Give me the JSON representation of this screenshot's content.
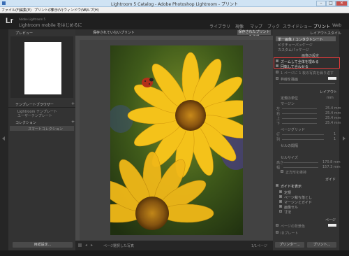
{
  "window": {
    "title": "Lightroom 5 Catalog - Adobe Photoshop Lightroom - プリント"
  },
  "menu": [
    "ファイル(F)",
    "編集(E)",
    "プリント(P)",
    "表示(V)",
    "ウィンドウ(W)",
    "ヘルプ(H)"
  ],
  "header": {
    "logo": "Lr",
    "id_small": "Adobe Lightroom 5",
    "id_plate": "Lightroom mobile をはじめるに"
  },
  "modules": [
    "ライブラリ",
    "現像",
    "マップ",
    "ブック",
    "スライドショー",
    "プリント",
    "Web"
  ],
  "left": {
    "preview": "プレビュー",
    "template_browser": "テンプレートブラウザー",
    "lr_templates": "Lightroom テンプレート",
    "user_templates": "ユーザーテンプレート",
    "collections": "コレクション",
    "smart_collection": "スマートコレクション",
    "page_setup": "用紙設定..."
  },
  "center": {
    "unsaved": "保存されていないプリント",
    "save_btn": "保存されたプリントを作成",
    "toolbar_label": "ページ",
    "toolbar_value": "選択した写真",
    "page_counter": "1/1ページ"
  },
  "right": {
    "layout_style": "レイアウトスタイル",
    "styles": [
      "単一画像 / コンタクトシート",
      "ピクチャーパッケージ",
      "カスタムパッケージ"
    ],
    "image_settings": "画像の設定",
    "zoom_fill": "ズームして全体を埋める",
    "rotate_fit": "回転して合わせる",
    "repeat": "1 ページに 1 枚の写真を繰り返す",
    "stroke_border": "枠線を描画",
    "layout": "レイアウト",
    "ruler_units": "定規の単位",
    "ruler_units_val": "mm",
    "margins": "マージン",
    "margin_rows": [
      [
        "左",
        "25.4 mm"
      ],
      [
        "右",
        "25.4 mm"
      ],
      [
        "上",
        "25.4 mm"
      ],
      [
        "下",
        "25.4 mm"
      ]
    ],
    "page_grid": "ページグリッド",
    "grid_rows": [
      [
        "行",
        "1"
      ],
      [
        "列",
        "1"
      ]
    ],
    "cell_spacing": "セルの間隔",
    "cell_size": "セルサイズ",
    "cell_rows": [
      [
        "高さ",
        "170.8 mm"
      ],
      [
        "幅",
        "157.3 mm"
      ]
    ],
    "keep_square": "正方形を維持",
    "guides": "ガイド",
    "show_guides": "ガイドを表示",
    "guide_items": [
      "定規",
      "ページ裁ち落とし",
      "マージンとガイド",
      "画像セル",
      "寸法"
    ],
    "page": "ページ",
    "page_bg": "ページの背景色",
    "identity": "IDプレート",
    "print_btn": "プリンター...",
    "print_to_btn": "プリント..."
  },
  "colors": {
    "highlight": "#e03a3a"
  }
}
